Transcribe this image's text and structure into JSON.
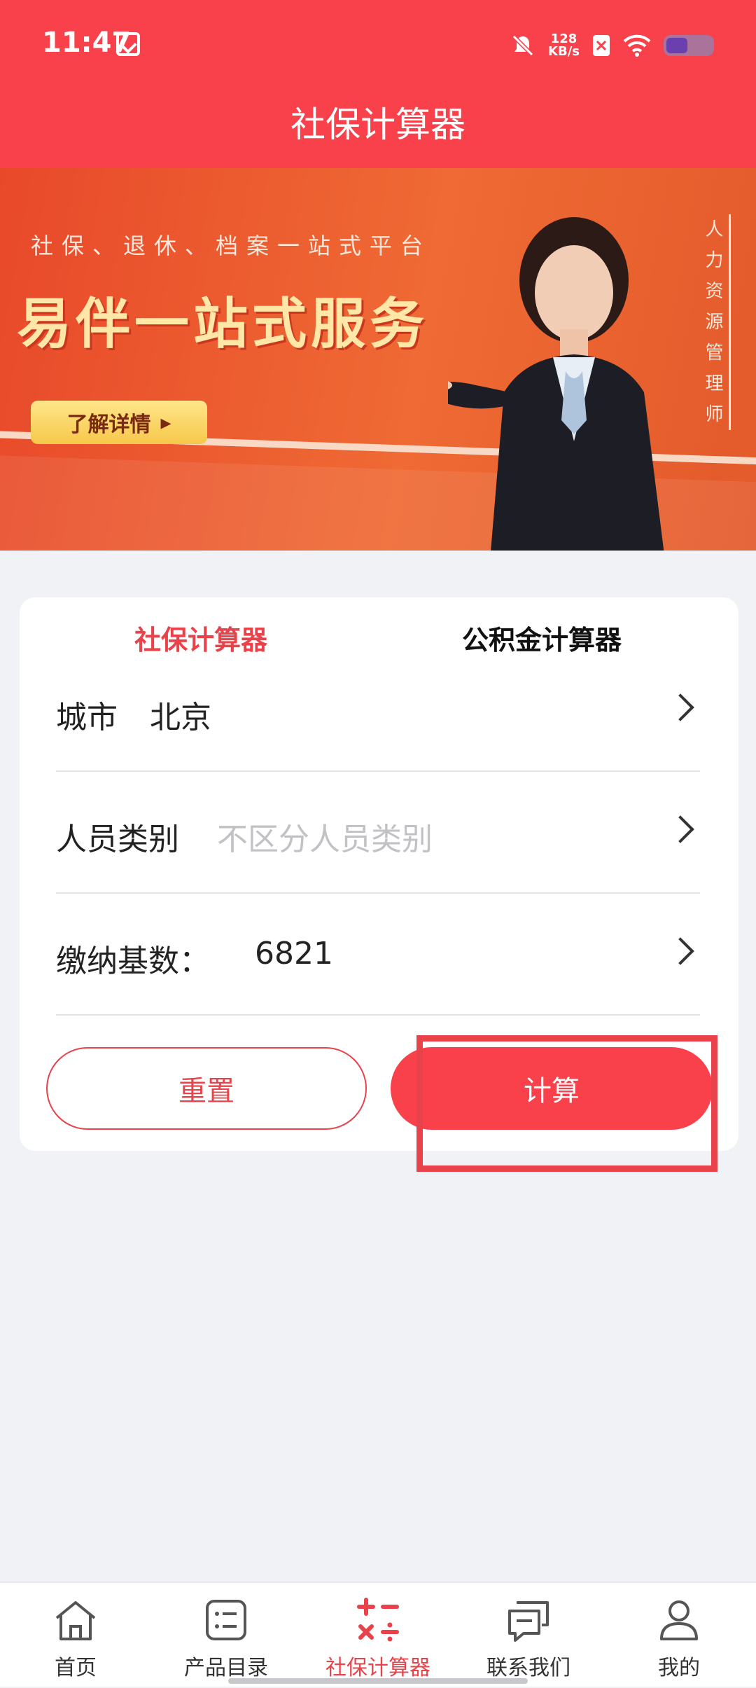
{
  "status": {
    "time": "11:47",
    "speed_top": "128",
    "speed_bottom": "KB/s"
  },
  "header": {
    "title": "社保计算器"
  },
  "banner": {
    "subtitle": "社保、退休、档案一站式平台",
    "headline": "易伴一站式服务",
    "cta": "了解详情",
    "vertical_text": "人力资源管理师"
  },
  "tabs": [
    {
      "label": "社保计算器",
      "active": true
    },
    {
      "label": "公积金计算器",
      "active": false
    }
  ],
  "form": {
    "city_label": "城市",
    "city_value": "北京",
    "category_label": "人员类别",
    "category_placeholder": "不区分人员类别",
    "base_label": "缴纳基数：",
    "base_value": "6821"
  },
  "buttons": {
    "reset": "重置",
    "calculate": "计算"
  },
  "nav": [
    {
      "label": "首页",
      "icon": "home-icon"
    },
    {
      "label": "产品目录",
      "icon": "list-icon"
    },
    {
      "label": "社保计算器",
      "icon": "calculator-icon",
      "active": true
    },
    {
      "label": "联系我们",
      "icon": "chat-icon"
    },
    {
      "label": "我的",
      "icon": "user-icon"
    }
  ],
  "colors": {
    "accent": "#f8414b",
    "text": "#222222",
    "placeholder": "#c1c1c6"
  }
}
